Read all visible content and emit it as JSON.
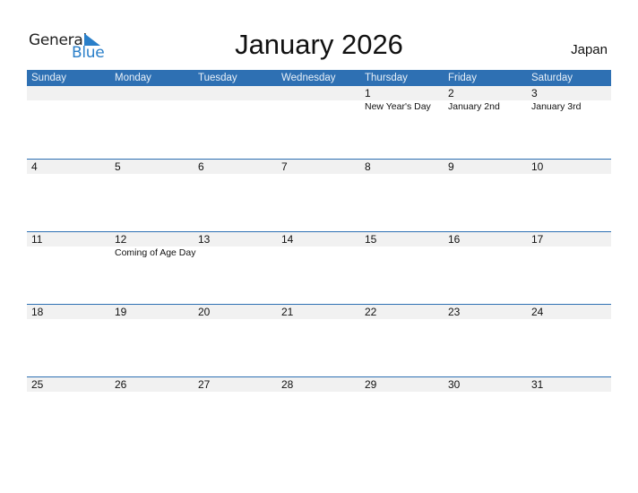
{
  "logo": {
    "word1": "General",
    "word2": "Blue",
    "icon": "triangle-flag-icon"
  },
  "title": "January 2026",
  "country": "Japan",
  "colors": {
    "header": "#2e70b3",
    "accent": "#2a7fc9",
    "band": "#f1f1f1"
  },
  "weekdays": [
    "Sunday",
    "Monday",
    "Tuesday",
    "Wednesday",
    "Thursday",
    "Friday",
    "Saturday"
  ],
  "weeks": [
    [
      {
        "day": "",
        "event": ""
      },
      {
        "day": "",
        "event": ""
      },
      {
        "day": "",
        "event": ""
      },
      {
        "day": "",
        "event": ""
      },
      {
        "day": "1",
        "event": "New Year's Day"
      },
      {
        "day": "2",
        "event": "January 2nd"
      },
      {
        "day": "3",
        "event": "January 3rd"
      }
    ],
    [
      {
        "day": "4",
        "event": ""
      },
      {
        "day": "5",
        "event": ""
      },
      {
        "day": "6",
        "event": ""
      },
      {
        "day": "7",
        "event": ""
      },
      {
        "day": "8",
        "event": ""
      },
      {
        "day": "9",
        "event": ""
      },
      {
        "day": "10",
        "event": ""
      }
    ],
    [
      {
        "day": "11",
        "event": ""
      },
      {
        "day": "12",
        "event": "Coming of Age Day"
      },
      {
        "day": "13",
        "event": ""
      },
      {
        "day": "14",
        "event": ""
      },
      {
        "day": "15",
        "event": ""
      },
      {
        "day": "16",
        "event": ""
      },
      {
        "day": "17",
        "event": ""
      }
    ],
    [
      {
        "day": "18",
        "event": ""
      },
      {
        "day": "19",
        "event": ""
      },
      {
        "day": "20",
        "event": ""
      },
      {
        "day": "21",
        "event": ""
      },
      {
        "day": "22",
        "event": ""
      },
      {
        "day": "23",
        "event": ""
      },
      {
        "day": "24",
        "event": ""
      }
    ],
    [
      {
        "day": "25",
        "event": ""
      },
      {
        "day": "26",
        "event": ""
      },
      {
        "day": "27",
        "event": ""
      },
      {
        "day": "28",
        "event": ""
      },
      {
        "day": "29",
        "event": ""
      },
      {
        "day": "30",
        "event": ""
      },
      {
        "day": "31",
        "event": ""
      }
    ]
  ]
}
